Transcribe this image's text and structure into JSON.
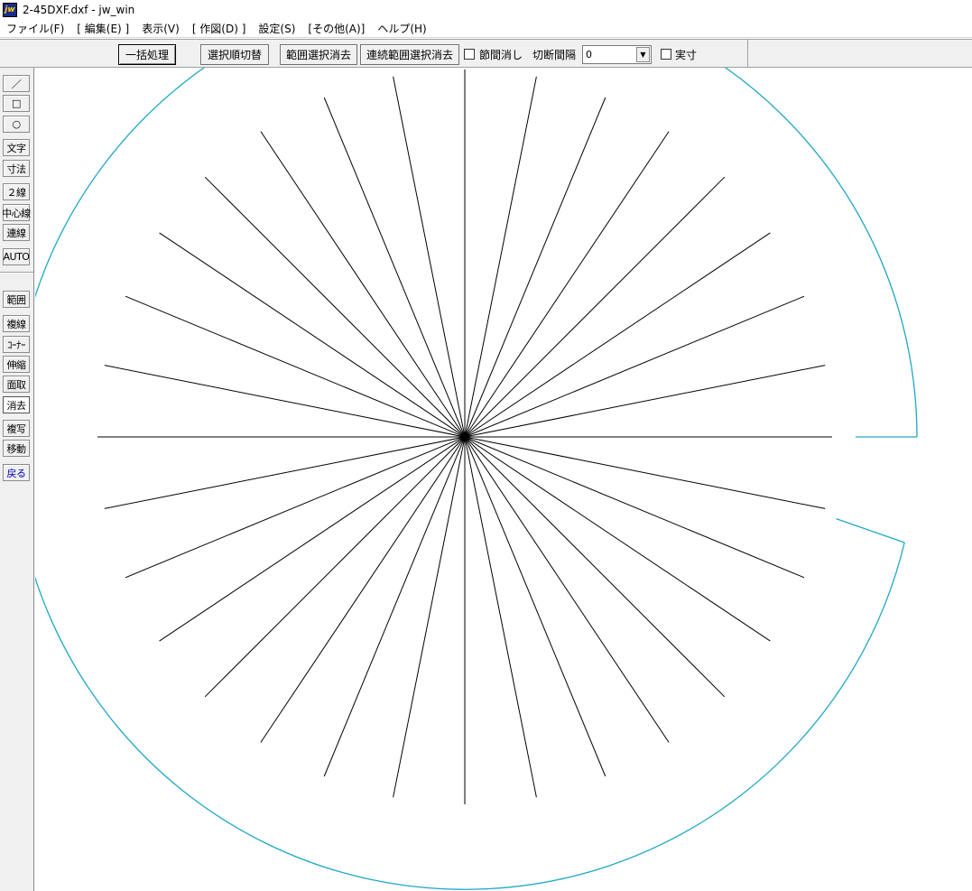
{
  "window": {
    "icon_text": "jw",
    "title": "2-45DXF.dxf - jw_win"
  },
  "menu": [
    "ファイル(F)",
    "[ 編集(E) ]",
    "表示(V)",
    "[ 作図(D) ]",
    "設定(S)",
    "[その他(A)]",
    "ヘルプ(H)"
  ],
  "toolbar": {
    "batch_process": "一括処理",
    "select_order_switch": "選択順切替",
    "range_select_delete": "範囲選択消去",
    "continuous_range_delete": "連続範囲選択消去",
    "segment_delete_label": "節間消し",
    "segment_delete_checked": false,
    "cut_interval_label": "切断間隔",
    "cut_interval_value": "0",
    "actual_size_label": "実寸",
    "actual_size_checked": false
  },
  "left_toolbar": [
    "／",
    "□",
    "○",
    "文字",
    "寸法",
    "２線",
    "中心線",
    "連線",
    "AUTO",
    "範囲",
    "複線",
    "ｺｰﾅｰ",
    "伸縮",
    "面取",
    "消去",
    "複写",
    "移動",
    "戻る"
  ],
  "active_tool": "消去",
  "drawing": {
    "ray_count": 32,
    "ray_color": "#000000",
    "arc_color": "#1fa8c4",
    "arc_gap_description": "circle broken between about -15° and 0°"
  }
}
